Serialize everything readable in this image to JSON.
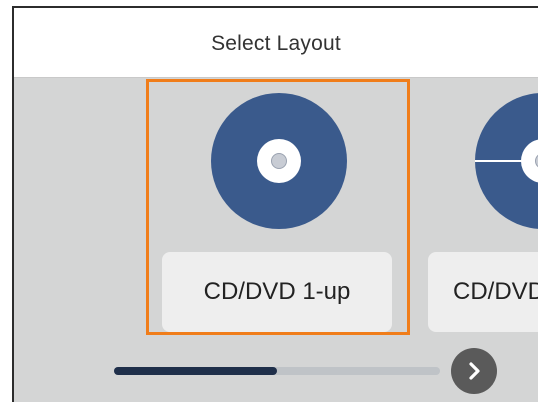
{
  "header": {
    "title": "Select Layout"
  },
  "layouts": [
    {
      "label": "CD/DVD 1-up",
      "icon": "disc-icon",
      "selected": true
    },
    {
      "label": "CD/DVD",
      "icon": "split-disc-icon",
      "selected": false
    }
  ],
  "pager": {
    "progress_fraction": 0.5,
    "next_icon": "chevron-right-icon"
  },
  "colors": {
    "selection": "#f07d1a",
    "disc": "#3a5a8c",
    "progress_fill": "#1f2f4a",
    "next_button": "#5a5a5a"
  }
}
